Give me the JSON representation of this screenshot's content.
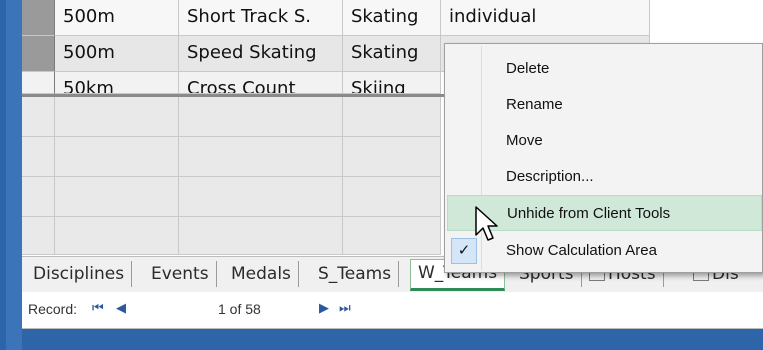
{
  "rows": [
    {
      "c1": "500m",
      "c2": "Short Track S.",
      "c3": "Skating",
      "c4": "individual"
    },
    {
      "c1": "500m",
      "c2": "Speed Skating",
      "c3": "Skating",
      "c4": ""
    },
    {
      "c1": "50km",
      "c2": "Cross Count",
      "c3": "Skiing",
      "c4": ""
    }
  ],
  "context_menu": {
    "items": [
      {
        "label": "Delete"
      },
      {
        "label": "Rename"
      },
      {
        "label": "Move"
      },
      {
        "label": "Description..."
      },
      {
        "label": "Unhide from Client Tools"
      },
      {
        "label": "Show Calculation Area",
        "check": "✓"
      }
    ]
  },
  "tabs": [
    {
      "label": "Disciplines"
    },
    {
      "label": "Events"
    },
    {
      "label": "Medals"
    },
    {
      "label": "S_Teams"
    },
    {
      "label": "W_Teams"
    },
    {
      "label": "Sports"
    },
    {
      "label": "Hosts"
    },
    {
      "label": "Dis"
    }
  ],
  "record": {
    "label": "Record:",
    "first_icon": "⏮",
    "prev_icon": "◀",
    "position": "1 of 58",
    "next_icon": "▶",
    "last_icon": "⏭"
  }
}
